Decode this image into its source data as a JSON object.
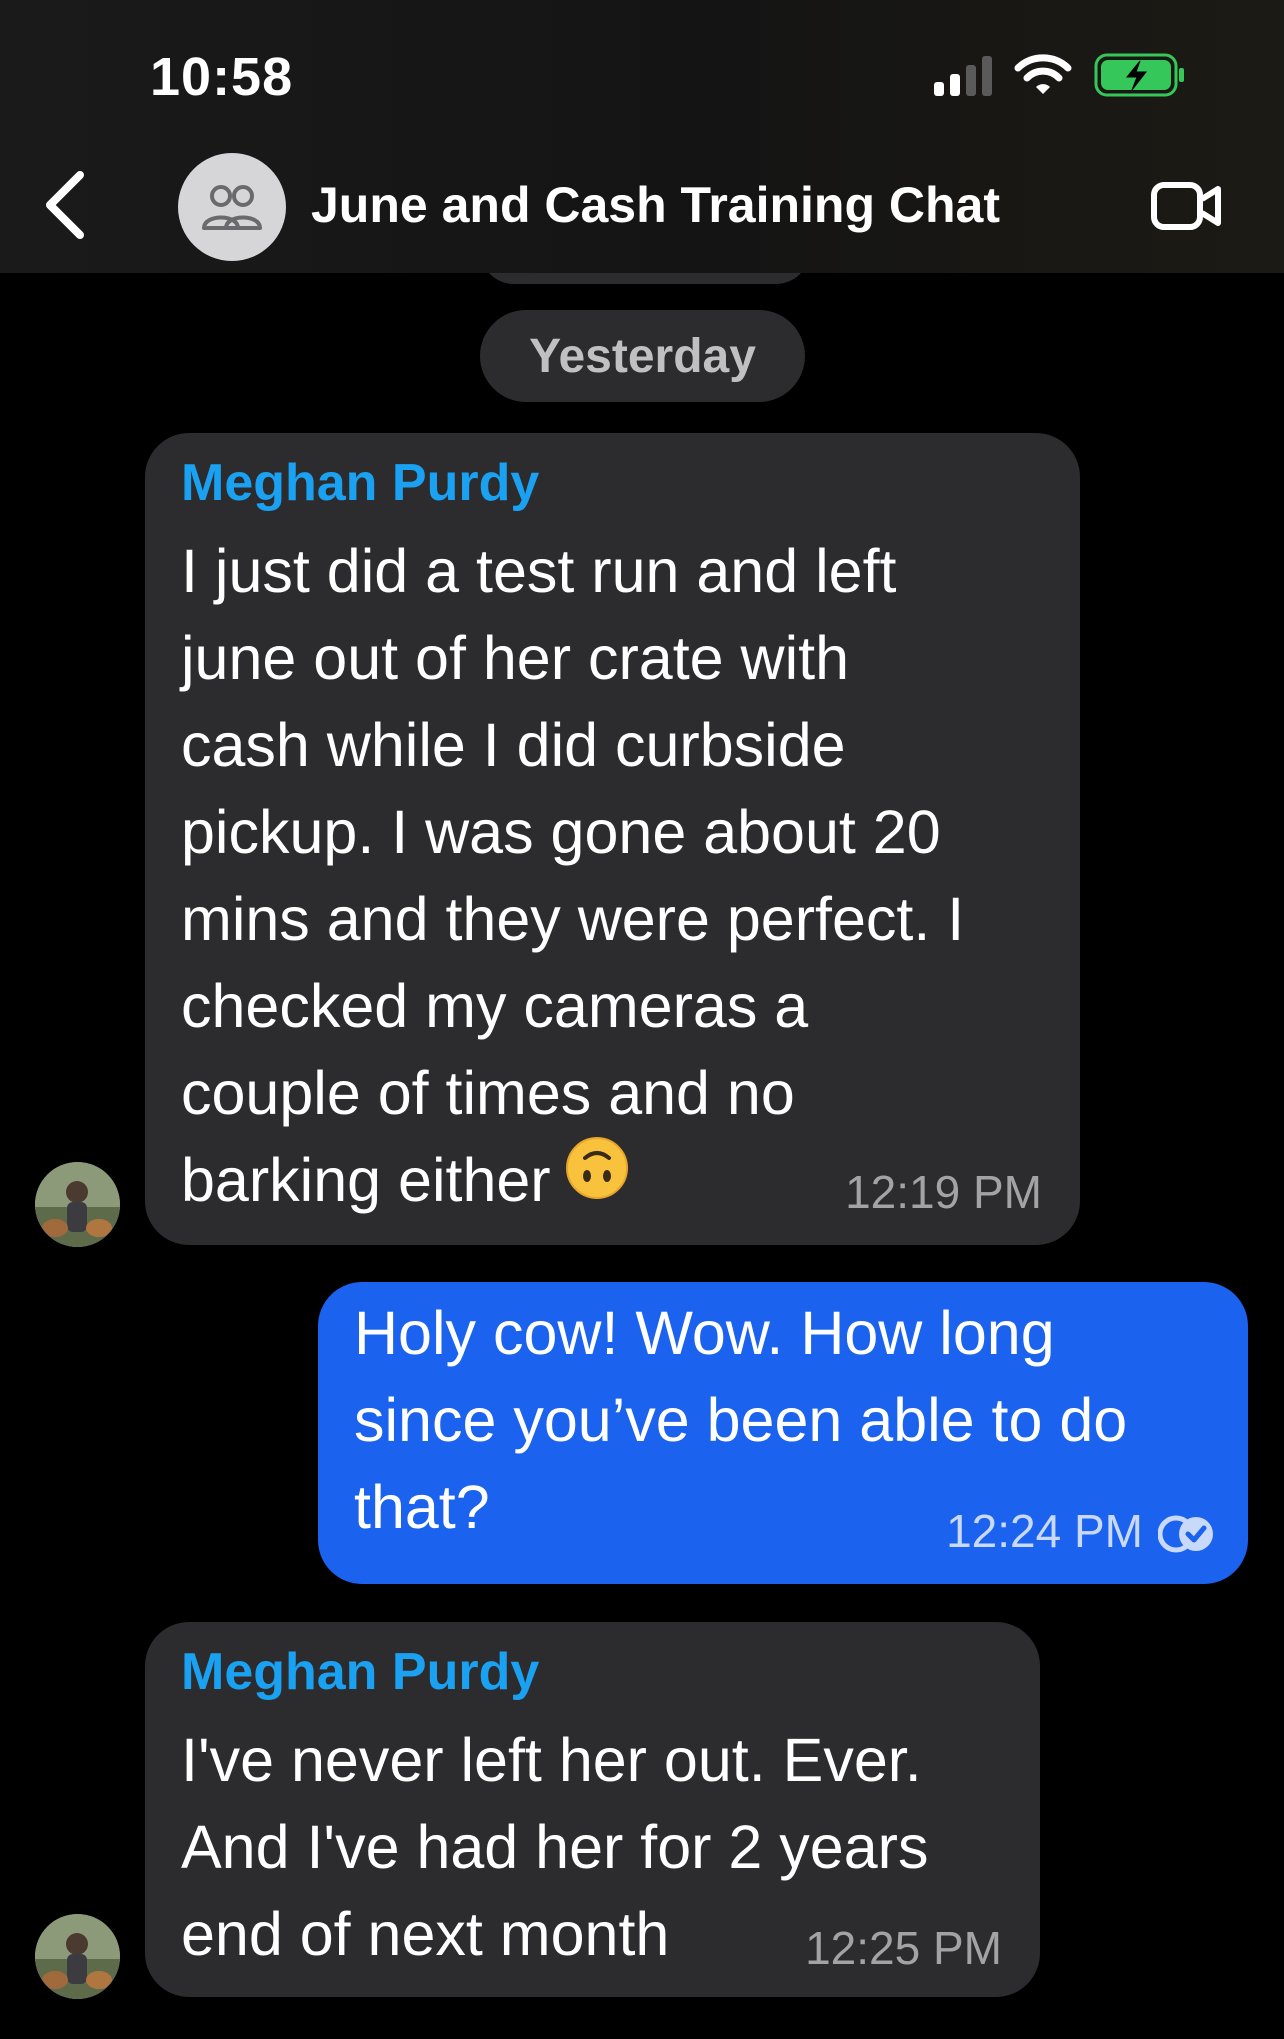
{
  "status_bar": {
    "time": "10:58"
  },
  "header": {
    "title": "June and Cash Training Chat",
    "back_icon": "chevron-left-icon",
    "group_icon": "group-people-icon",
    "video_icon": "video-camera-icon"
  },
  "date_separator": "Yesterday",
  "messages": [
    {
      "direction": "incoming",
      "sender": "Meghan Purdy",
      "lines": [
        "I just did a test run and left",
        "june out of her crate with",
        "cash while I did curbside",
        "pickup. I was gone about 20",
        "mins and they were perfect. I",
        "checked my cameras a",
        "couple of times and no",
        "barking either"
      ],
      "emoji": "upside-down-face",
      "time": "12:19 PM"
    },
    {
      "direction": "outgoing",
      "lines": [
        "Holy cow! Wow. How long",
        "since you’ve been able to do",
        "that?"
      ],
      "time": "12:24 PM",
      "status_icon": "read-receipt-icon"
    },
    {
      "direction": "incoming",
      "sender": "Meghan Purdy",
      "lines": [
        "I've never left her out. Ever.",
        "And I've had her for 2 years",
        "end of next month"
      ],
      "time": "12:25 PM"
    }
  ],
  "colors": {
    "background": "#000000",
    "incoming_bubble": "#2c2c2e",
    "outgoing_bubble": "#1b62ee",
    "sender_name": "#1ba1f2",
    "battery_green": "#35c759"
  }
}
